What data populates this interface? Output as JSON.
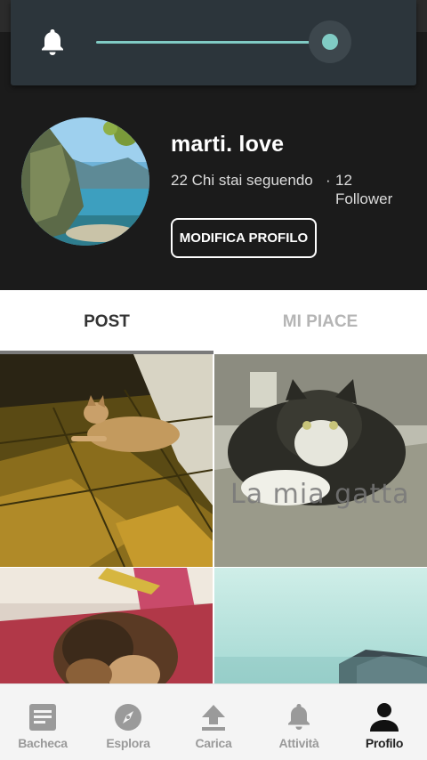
{
  "volume": {
    "icon": "bell-icon",
    "level": 0.95,
    "accent_color": "#80cbc4"
  },
  "profile": {
    "username": "marti. love",
    "following_text": "22 Chi stai seguendo",
    "separator": "·",
    "followers_count": "12",
    "followers_label": "Follower",
    "edit_button_label": "MODIFICA PROFILO"
  },
  "tabs": [
    {
      "label": "POST",
      "active": true
    },
    {
      "label": "MI PIACE",
      "active": false
    }
  ],
  "posts": [
    {
      "subject": "dog on tiled floor"
    },
    {
      "subject": "cat",
      "caption": "La mia gatta"
    },
    {
      "subject": "cat sleeping on blanket"
    },
    {
      "subject": "mountain landscape sky"
    }
  ],
  "nav": [
    {
      "label": "Bacheca",
      "icon": "feed-icon",
      "active": false
    },
    {
      "label": "Esplora",
      "icon": "compass-icon",
      "active": false
    },
    {
      "label": "Carica",
      "icon": "upload-icon",
      "active": false
    },
    {
      "label": "Attività",
      "icon": "bell-icon",
      "active": false
    },
    {
      "label": "Profilo",
      "icon": "person-icon",
      "active": true
    }
  ]
}
